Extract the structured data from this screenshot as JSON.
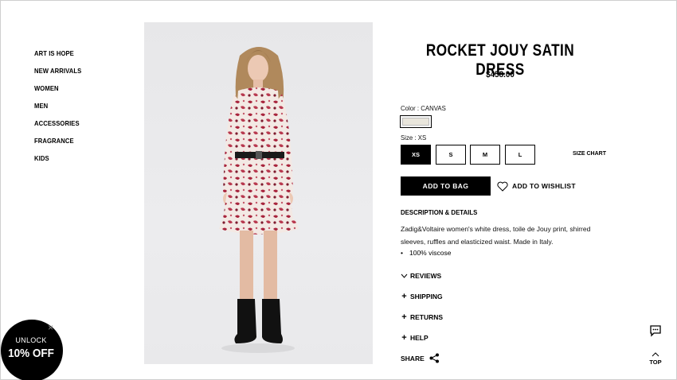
{
  "nav": {
    "items": [
      {
        "label": "ART IS HOPE"
      },
      {
        "label": "NEW ARRIVALS"
      },
      {
        "label": "WOMEN"
      },
      {
        "label": "MEN"
      },
      {
        "label": "ACCESSORIES"
      },
      {
        "label": "FRAGRANCE"
      },
      {
        "label": "KIDS"
      }
    ]
  },
  "product": {
    "title": "ROCKET JOUY SATIN DRESS",
    "price": "$458.00",
    "color_label": "Color : CANVAS",
    "swatch_color": "#e9e6dc",
    "size_label": "Size : XS",
    "sizes": [
      {
        "label": "XS",
        "selected": true
      },
      {
        "label": "S",
        "selected": false
      },
      {
        "label": "M",
        "selected": false
      },
      {
        "label": "L",
        "selected": false
      }
    ],
    "size_chart": "SIZE CHART",
    "add_to_bag": "ADD TO BAG",
    "add_to_wishlist": "ADD TO WISHLIST",
    "description_title": "DESCRIPTION & DETAILS",
    "description": "Zadig&Voltaire women's white dress, toile de Jouy print, shirred sleeves, ruffles and elasticized waist. Made in Italy.",
    "bullets": [
      "100% viscose"
    ],
    "accordions": [
      {
        "label": "REVIEWS",
        "icon": "chevron-down"
      },
      {
        "label": "SHIPPING",
        "icon": "plus"
      },
      {
        "label": "RETURNS",
        "icon": "plus"
      },
      {
        "label": "HELP",
        "icon": "plus"
      }
    ],
    "share": "SHARE"
  },
  "promo": {
    "line1": "UNLOCK",
    "line2": "10% OFF",
    "close": "×"
  },
  "top_label": "TOP",
  "colors": {
    "accent": "#000000",
    "print_red": "#a8243c"
  }
}
